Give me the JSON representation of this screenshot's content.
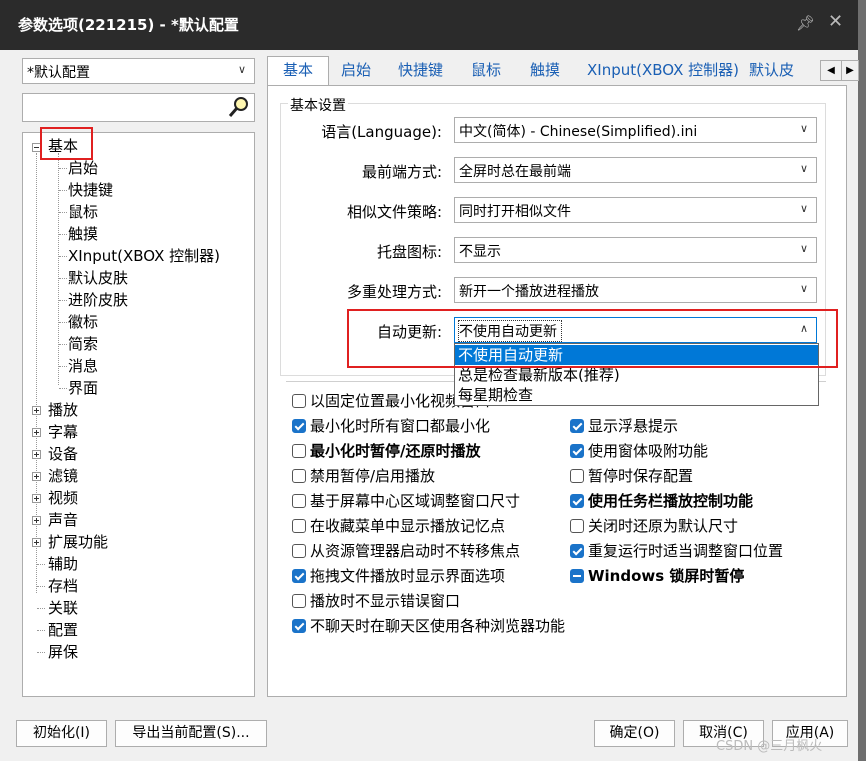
{
  "window": {
    "title": "参数选项(221215) - *默认配置",
    "pin_icon": "pin-icon",
    "close_icon": "close-icon"
  },
  "profile": {
    "value": "*默认配置"
  },
  "search": {
    "value": "",
    "icon": "search-icon"
  },
  "tree": {
    "root": "基本",
    "children": [
      "启始",
      "快捷键",
      "鼠标",
      "触摸",
      "XInput(XBOX 控制器)",
      "默认皮肤",
      "进阶皮肤",
      "徽标",
      "简索",
      "消息",
      "界面"
    ],
    "collapsed": [
      "播放",
      "字幕",
      "设备",
      "滤镜",
      "视频",
      "声音",
      "扩展功能"
    ],
    "leaves": [
      "辅助",
      "存档",
      "关联",
      "配置",
      "屏保"
    ]
  },
  "tabs": [
    "基本",
    "启始",
    "快捷键",
    "鼠标",
    "触摸",
    "XInput(XBOX 控制器)",
    "默认皮"
  ],
  "basic": {
    "group_title": "基本设置",
    "rows": [
      {
        "label": "语言(Language):",
        "value": "中文(简体) - Chinese(Simplified).ini"
      },
      {
        "label": "最前端方式:",
        "value": "全屏时总在最前端"
      },
      {
        "label": "相似文件策略:",
        "value": "同时打开相似文件"
      },
      {
        "label": "托盘图标:",
        "value": "不显示"
      },
      {
        "label": "多重处理方式:",
        "value": "新开一个播放进程播放"
      },
      {
        "label": "自动更新:",
        "value": "不使用自动更新"
      }
    ],
    "dropdown_options": [
      "不使用自动更新",
      "总是检查最新版本(推荐)",
      "每星期检查"
    ]
  },
  "checkboxes_left": [
    {
      "label": "以固定位置最小化视频窗口",
      "state": "off"
    },
    {
      "label": "最小化时所有窗口都最小化",
      "state": "on"
    },
    {
      "label": "最小化时暂停/还原时播放",
      "state": "off",
      "bold": true
    },
    {
      "label": "禁用暂停/启用播放",
      "state": "off"
    },
    {
      "label": "基于屏幕中心区域调整窗口尺寸",
      "state": "off"
    },
    {
      "label": "在收藏菜单中显示播放记忆点",
      "state": "off"
    },
    {
      "label": "从资源管理器启动时不转移焦点",
      "state": "off"
    },
    {
      "label": "拖拽文件播放时显示界面选项",
      "state": "on"
    },
    {
      "label": "播放时不显示错误窗口",
      "state": "off"
    },
    {
      "label": "不聊天时在聊天区使用各种浏览器功能",
      "state": "on"
    }
  ],
  "checkboxes_right": [
    {
      "label": "显示浮悬提示",
      "state": "on"
    },
    {
      "label": "使用窗体吸附功能",
      "state": "on"
    },
    {
      "label": "暂停时保存配置",
      "state": "off"
    },
    {
      "label": "使用任务栏播放控制功能",
      "state": "on",
      "bold": true
    },
    {
      "label": "关闭时还原为默认尺寸",
      "state": "off"
    },
    {
      "label": "重复运行时适当调整窗口位置",
      "state": "on"
    },
    {
      "label": "Windows 锁屏时暂停",
      "state": "ind",
      "bold": true
    }
  ],
  "buttons": {
    "init": "初始化(I)",
    "export": "导出当前配置(S)...",
    "ok": "确定(O)",
    "cancel": "取消(C)",
    "apply": "应用(A)"
  },
  "watermark": "CSDN @三月枫火"
}
